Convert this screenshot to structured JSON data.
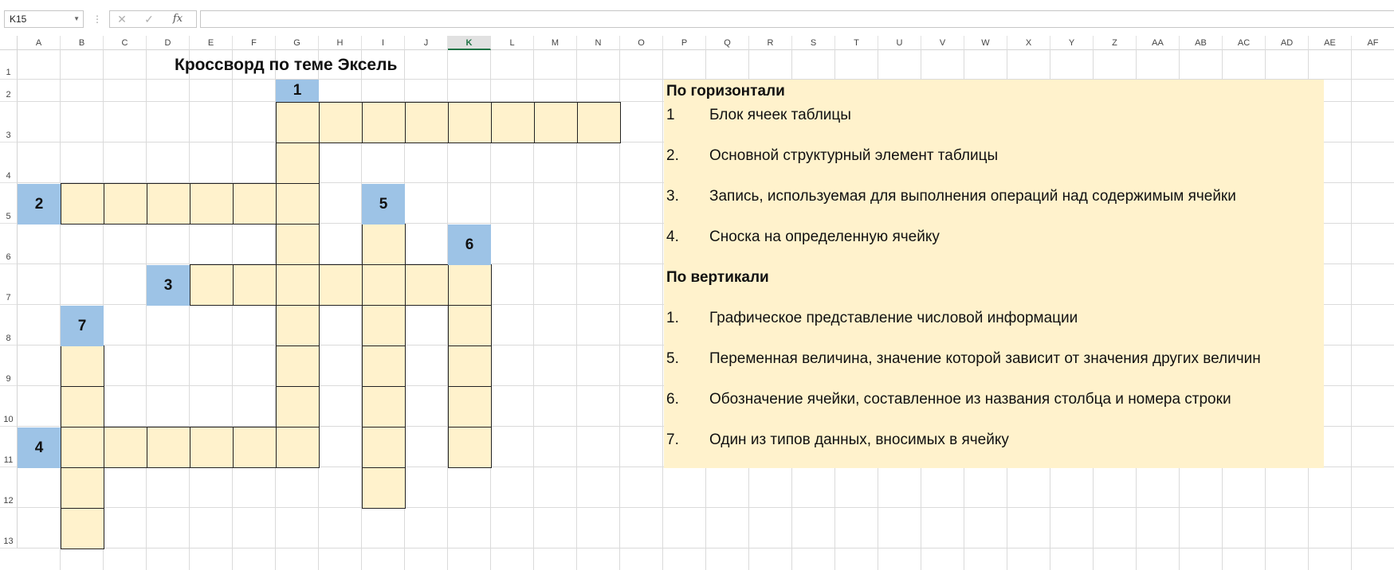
{
  "formula_bar": {
    "name_box": "K15",
    "cancel_icon": "✕",
    "enter_icon": "✓",
    "fx_label": "fx",
    "formula_value": ""
  },
  "columns": [
    "A",
    "B",
    "C",
    "D",
    "E",
    "F",
    "G",
    "H",
    "I",
    "J",
    "K",
    "L",
    "M",
    "N",
    "O",
    "P",
    "Q",
    "R",
    "S",
    "T",
    "U",
    "V",
    "W",
    "X",
    "Y",
    "Z",
    "AA",
    "AB",
    "AC",
    "AD",
    "AE",
    "AF"
  ],
  "selected_column": "K",
  "rows": [
    "1",
    "2",
    "3",
    "4",
    "5",
    "6",
    "7",
    "8",
    "9",
    "10",
    "11",
    "12",
    "13"
  ],
  "title": "Кроссворд по теме Эксель",
  "clue_numbers": [
    "1",
    "2",
    "3",
    "4",
    "5",
    "6",
    "7"
  ],
  "clues": {
    "across_heading": "По горизонтали",
    "across": [
      {
        "n": "1",
        "text": "Блок ячеек таблицы"
      },
      {
        "n": "2.",
        "text": "Основной структурный элемент таблицы"
      },
      {
        "n": "3.",
        "text": "Запись, используемая для выполнения операций над содержимым ячейки"
      },
      {
        "n": "4.",
        "text": "Сноска на определенную ячейку"
      }
    ],
    "down_heading": "По вертикали",
    "down": [
      {
        "n": "1.",
        "text": "Графическое представление числовой информации"
      },
      {
        "n": "5.",
        "text": "Переменная величина, значение которой зависит от значения других величин"
      },
      {
        "n": "6.",
        "text": "Обозначение ячейки, составленное из названия столбца и номера строки"
      },
      {
        "n": "7.",
        "text": "Один из типов данных, вносимых в ячейку"
      }
    ]
  },
  "colors": {
    "answer_cell": "#fff2cc",
    "number_cell": "#9dc3e6",
    "clue_background": "#fff2cc",
    "selected_header_accent": "#217346"
  }
}
